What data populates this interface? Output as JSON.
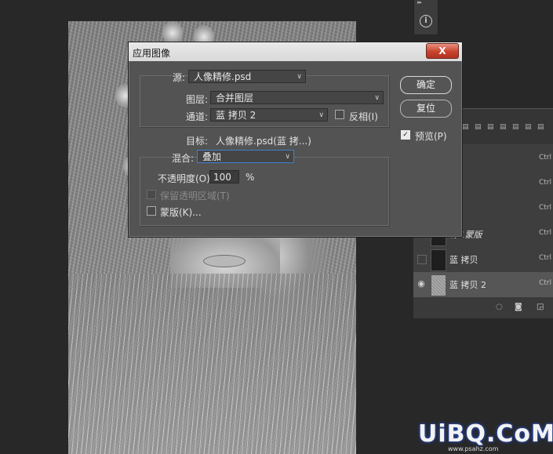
{
  "dialog": {
    "title": "应用图像",
    "close_label": "X",
    "source": {
      "label": "源:",
      "value": "人像精修.psd"
    },
    "layer": {
      "label": "图层:",
      "value": "合并图层"
    },
    "channel": {
      "label": "通道:",
      "value": "蓝 拷贝 2"
    },
    "invert": {
      "label": "反相(I)",
      "checked": false
    },
    "target": {
      "label": "目标:",
      "value": "人像精修.psd(蓝 拷...)"
    },
    "blend": {
      "label": "混合:",
      "value": "叠加"
    },
    "opacity": {
      "label": "不透明度(O):",
      "value": "100",
      "unit": "%"
    },
    "preserve_transparency": {
      "label": "保留透明区域(T)",
      "enabled": false
    },
    "mask": {
      "label": "蒙版(K)..."
    },
    "ok_label": "确定",
    "reset_label": "复位",
    "preview": {
      "label": "预览(P)",
      "checked": true
    }
  },
  "info_panel": {
    "icon": "info-icon"
  },
  "layers_panel": {
    "rows": [
      {
        "name": "",
        "shortcut": "Ctrl",
        "visible": false
      },
      {
        "name": "",
        "shortcut": "Ctrl",
        "visible": false
      },
      {
        "name": "",
        "shortcut": "Ctrl",
        "visible": false
      },
      {
        "name": "线 1蒙版",
        "shortcut": "Ctrl",
        "visible": false
      },
      {
        "name": "蓝 拷贝",
        "shortcut": "Ctrl",
        "visible": false
      },
      {
        "name": "蓝 拷贝 2",
        "shortcut": "Ctrl",
        "visible": true,
        "selected": true
      }
    ]
  },
  "watermark": {
    "text": "UiBQ.CoM",
    "url": "www.psahz.com"
  }
}
